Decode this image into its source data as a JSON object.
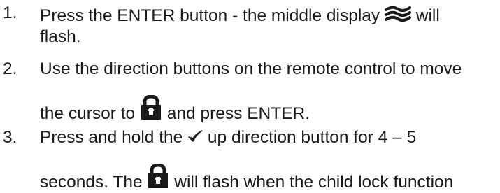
{
  "steps": [
    {
      "number": "1.",
      "line1_before": "Press the ENTER button - the middle display ",
      "icon1": "airflow-waves-icon",
      "line1_after": " will",
      "line2": "flash."
    },
    {
      "number": "2.",
      "line1": "Use the direction buttons on the remote control to move",
      "line2_before": "the cursor to ",
      "icon": "padlock-icon",
      "line2_after": " and press ENTER."
    },
    {
      "number": "3.",
      "line1_before": "Press and hold the ",
      "icon1": "checkmark-icon",
      "line1_after": " up direction button for 4 – 5",
      "line2_before": "seconds.  The ",
      "icon2": "padlock-icon",
      "line2_after": " will flash when the child lock function"
    }
  ],
  "colors": {
    "text": "#1a1a1a"
  }
}
